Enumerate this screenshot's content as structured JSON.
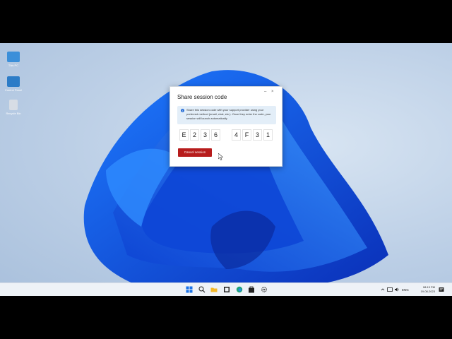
{
  "desktop": {
    "icons": [
      {
        "label": "This PC",
        "name": "this-pc-icon",
        "color": "#3b8fd9"
      },
      {
        "label": "Control Panel",
        "name": "control-panel-icon",
        "color": "#2c7cc7"
      },
      {
        "label": "Recycle Bin",
        "name": "recycle-bin-icon",
        "color": "#d7dde5"
      }
    ]
  },
  "dialog": {
    "title": "Share session code",
    "minimize_glyph": "–",
    "close_glyph": "×",
    "info_text": "Share this session code with your support provider using your preferred method (email, chat, etc.). Once they enter the code, your session will launch automatically.",
    "code": [
      "E",
      "2",
      "3",
      "6",
      "4",
      "F",
      "3",
      "1"
    ],
    "cancel_label": "Cancel session",
    "accent": "#b71c1c"
  },
  "taskbar": {
    "language": "ENG",
    "time": "08:13 PM",
    "date": "19-08-2023"
  }
}
